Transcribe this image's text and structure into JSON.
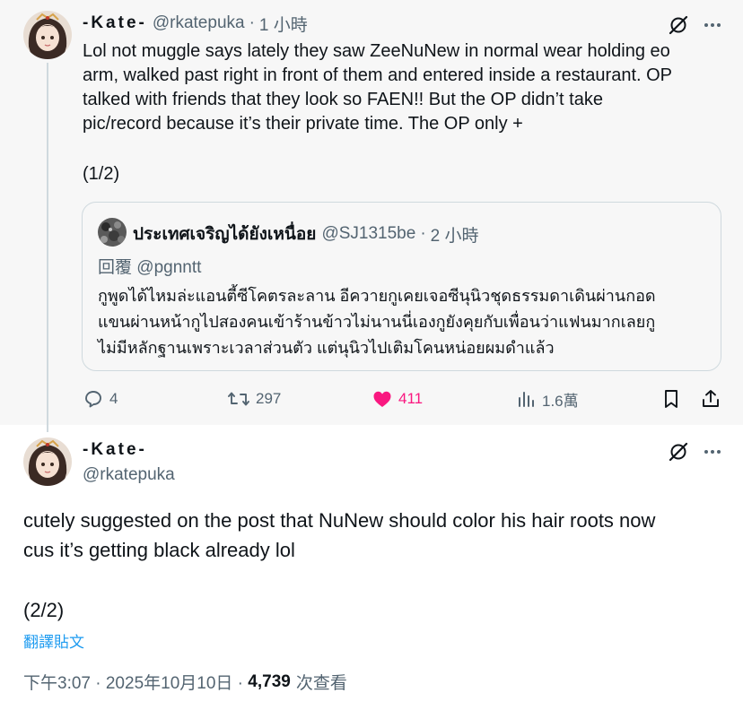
{
  "tweet1": {
    "author_name": "-Kate-",
    "author_handle": "@rkatepuka",
    "separator": "·",
    "time": "1 小時",
    "body_lines": [
      "Lol not muggle says lately they saw ZeeNuNew in normal wear holding eo",
      "arm, walked past right in front of them and entered inside a restaurant. OP",
      "talked with friends that they look so FAEN!! But the OP didn’t take",
      "pic/record because it’s their private time. The OP only +"
    ],
    "part": "(1/2)",
    "quote": {
      "author_name": "ประเทศเจริญได้ยังเหนื่อย",
      "author_handle": "@SJ1315be",
      "separator": "·",
      "time": "2 小時",
      "reply_prefix": "回覆",
      "reply_to": "@pgnntt",
      "text_lines": [
        "กูพูดได้ไหมล่ะแอนตี้ซีโคตรละลาน อีควายกูเคยเจอซีนุนิวชุดธรรมดาเดินผ่านกอด",
        "แขนผ่านหน้ากูไปสองคนเข้าร้านข้าวไม่นานนี่เองกูยังคุยกับเพื่อนว่าแฟนมากเลยกู",
        "ไม่มีหลักฐานเพราะเวลาส่วนตัว แต่นุนิวไปเติมโคนหน่อยผมดำแล้ว"
      ]
    },
    "actions": {
      "replies": "4",
      "retweets": "297",
      "likes": "411",
      "views": "1.6萬"
    }
  },
  "tweet2": {
    "author_name": "-Kate-",
    "author_handle": "@rkatepuka",
    "body_lines": [
      "cutely suggested on the post that NuNew should color his hair roots now",
      "cus it’s getting black already lol"
    ],
    "part": "(2/2)",
    "translate_label": "翻譯貼文",
    "timestamp": "下午3:07 · 2025年10月10日 ·",
    "views_count": "4,739",
    "views_label": "次查看"
  },
  "colors": {
    "like_active": "#f91880",
    "link": "#1d9bf0",
    "muted": "#536471",
    "border": "#cfd9de"
  },
  "icons": [
    "grok-icon",
    "more-icon",
    "reply-icon",
    "retweet-icon",
    "heart-icon",
    "views-icon",
    "bookmark-icon",
    "share-icon"
  ]
}
